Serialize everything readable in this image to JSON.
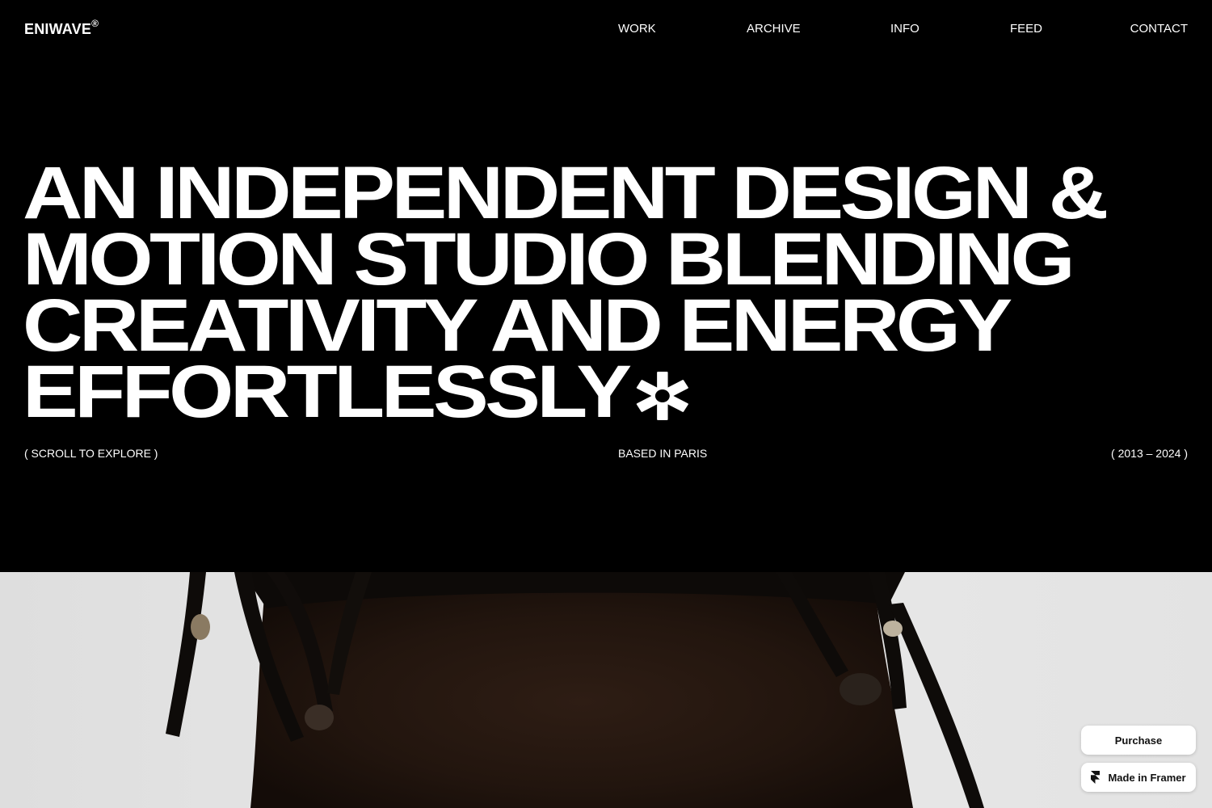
{
  "header": {
    "logo": "ENIWAVE",
    "logo_mark": "®",
    "nav": [
      {
        "label": "WORK"
      },
      {
        "label": "ARCHIVE"
      },
      {
        "label": "INFO"
      },
      {
        "label": "FEED"
      },
      {
        "label": "CONTACT"
      }
    ]
  },
  "hero": {
    "headline_lines": [
      "AN INDEPENDENT DESIGN &",
      "MOTION STUDIO BLENDING",
      "CREATIVITY AND ENERGY",
      "EFFORTLESSLY"
    ],
    "headline_icon": "asterisk-icon",
    "scroll_hint": "( SCROLL TO EXPLORE )",
    "location": "BASED IN PARIS",
    "years": "( 2013 – 2024 )"
  },
  "media": {
    "hero_image": "portrait-photo"
  },
  "badges": {
    "purchase": "Purchase",
    "made_in": "Made in Framer",
    "made_in_icon": "framer-logo-icon"
  },
  "colors": {
    "background": "#000000",
    "text": "#ffffff",
    "photo_background": "#e6e6e6",
    "badge_background": "#ffffff",
    "badge_text": "#111111"
  }
}
